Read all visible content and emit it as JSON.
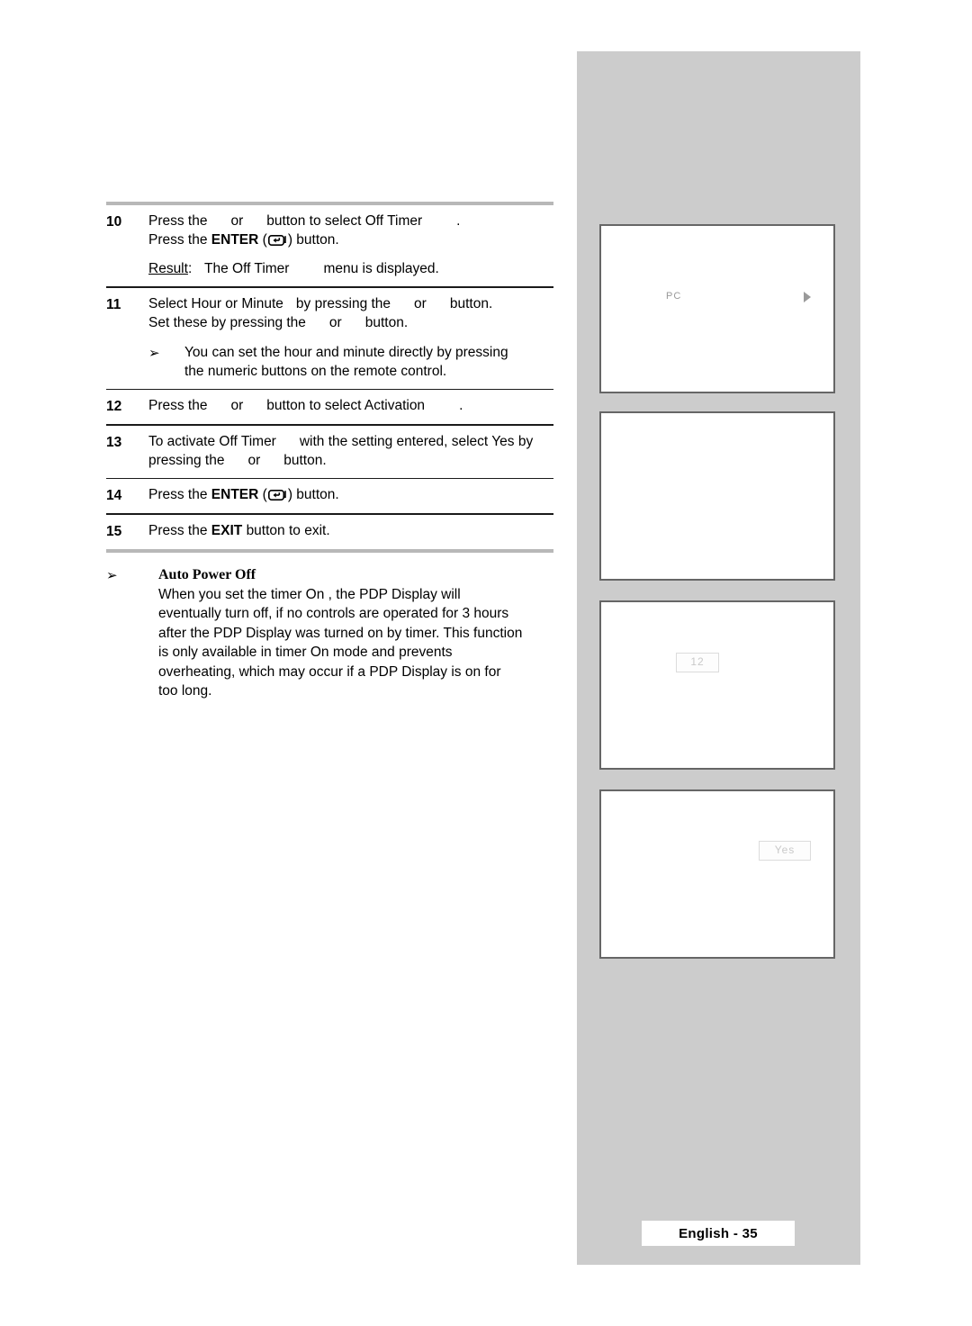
{
  "page": {
    "footer_label": "English - 35",
    "language": "English",
    "page_number": "35"
  },
  "colors": {
    "sidebar_bg": "#cccccc",
    "panel_border": "#666666",
    "panel_bg": "#ffffff",
    "osd_text": "#9a9a9a",
    "rule_light": "#b8b8b8",
    "rule_dark": "#1a1a1a",
    "text": "#000000"
  },
  "steps": [
    {
      "number": "10",
      "lines": [
        "Press the",
        "or",
        "button to select Off Timer",
        "."
      ],
      "line2_prefix": "Press the",
      "line2_keyword": "ENTER",
      "line2_suffix": ") button.",
      "line2_open_paren": "(",
      "result": {
        "label": "Result",
        "colon": ":",
        "text_a": "The Off Timer",
        "text_b": "menu is displayed."
      }
    },
    {
      "number": "11",
      "line1_a": "Select Hour",
      "line1_b": "or Minute",
      "line1_c": "by pressing the",
      "line1_d": "or",
      "line1_e": "button.",
      "line2_a": "Set these by pressing the",
      "line2_b": "or",
      "line2_c": "button.",
      "note": {
        "bullet": "➢",
        "line1": "You can set the hour and minute directly by pressing",
        "line2": "the numeric buttons on the remote control."
      }
    },
    {
      "number": "12",
      "line1_a": "Press the",
      "line1_b": "or",
      "line1_c": "button to select Activation",
      "line1_d": "."
    },
    {
      "number": "13",
      "line1_a": "To activate Off Timer",
      "line1_b": "with the setting entered, select Yes by",
      "line2_a": "pressing the",
      "line2_b": "or",
      "line2_c": "button."
    },
    {
      "number": "14",
      "line1_prefix": "Press the",
      "line1_keyword": "ENTER",
      "line1_open_paren": "(",
      "line1_suffix": ") button."
    },
    {
      "number": "15",
      "line1_prefix": "Press the",
      "line1_keyword": "EXIT",
      "line1_suffix": "button to exit."
    }
  ],
  "auto_power_off": {
    "bullet": "➢",
    "title": "Auto Power Off",
    "line1": "When you set the timer  On , the PDP Display will",
    "line2": "eventually turn off, if no controls are operated for 3 hours",
    "line3": "after the PDP Display was turned on by timer. This function",
    "line4": "is only available in timer  On  mode and prevents",
    "line5": "overheating, which may occur if a PDP Display is on for",
    "line6": "too long."
  },
  "sidebar": {
    "panels": [
      {
        "name": "panel-pc-menu",
        "osd_label": "PC",
        "has_arrow": true
      },
      {
        "name": "panel-blank",
        "osd_label": "",
        "has_arrow": false
      },
      {
        "name": "panel-time-value",
        "osd_box_value": "12"
      },
      {
        "name": "panel-activation-value",
        "osd_box_value": "Yes"
      }
    ]
  }
}
